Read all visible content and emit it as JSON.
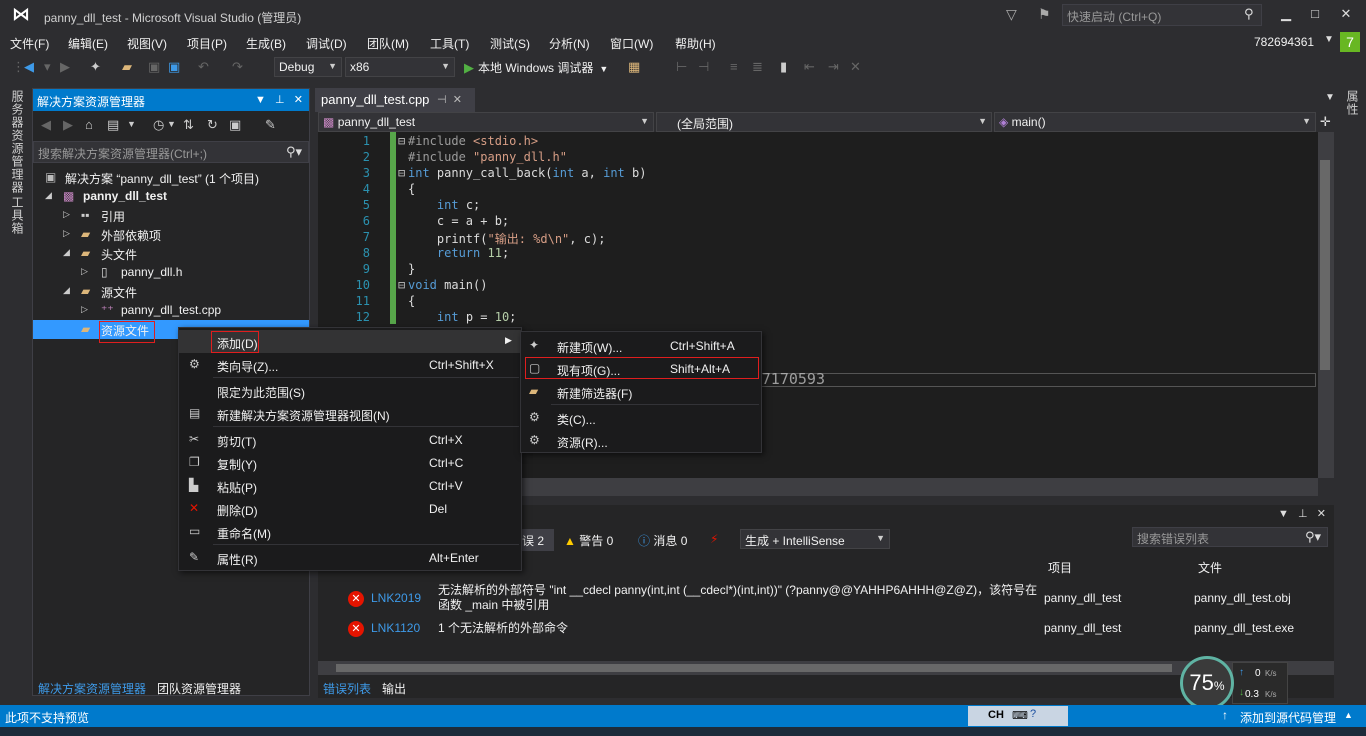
{
  "window": {
    "title": "panny_dll_test - Microsoft Visual Studio (管理员)",
    "quick_launch_placeholder": "快速启动 (Ctrl+Q)",
    "minimize": "▁",
    "maximize": "□",
    "close": "✕"
  },
  "menu": [
    "文件(F)",
    "编辑(E)",
    "视图(V)",
    "项目(P)",
    "生成(B)",
    "调试(D)",
    "团队(M)",
    "工具(T)",
    "测试(S)",
    "分析(N)",
    "窗口(W)",
    "帮助(H)"
  ],
  "account": {
    "id": "782694361",
    "notification_count": "7"
  },
  "toolbar": {
    "config": "Debug",
    "platform": "x86",
    "run_label": "本地 Windows 调试器"
  },
  "left_vtabs": [
    "服务器资源管理器",
    "工具箱"
  ],
  "right_vtab": "属性",
  "solution_explorer": {
    "title": "解决方案资源管理器",
    "search_placeholder": "搜索解决方案资源管理器(Ctrl+;)",
    "tree": [
      {
        "label": "解决方案 “panny_dll_test” (1 个项目)",
        "level": 0,
        "expander": "",
        "icon": "solution-icon",
        "bold": false
      },
      {
        "label": "panny_dll_test",
        "level": 1,
        "expander": "◢",
        "icon": "project-icon",
        "bold": true
      },
      {
        "label": "引用",
        "level": 2,
        "expander": "▷",
        "icon": "references-icon",
        "bold": false
      },
      {
        "label": "外部依赖项",
        "level": 2,
        "expander": "▷",
        "icon": "folder-icon",
        "bold": false
      },
      {
        "label": "头文件",
        "level": 2,
        "expander": "◢",
        "icon": "folder-icon",
        "bold": false
      },
      {
        "label": "panny_dll.h",
        "level": 3,
        "expander": "▷",
        "icon": "header-file-icon",
        "bold": false
      },
      {
        "label": "源文件",
        "level": 2,
        "expander": "◢",
        "icon": "folder-icon",
        "bold": false
      },
      {
        "label": "panny_dll_test.cpp",
        "level": 3,
        "expander": "▷",
        "icon": "cpp-file-icon",
        "bold": false
      },
      {
        "label": "资源文件",
        "level": 2,
        "expander": "",
        "icon": "folder-icon",
        "bold": false
      }
    ],
    "bottom_tabs": [
      "解决方案资源管理器",
      "团队资源管理器"
    ]
  },
  "editor": {
    "tab_label": "panny_dll_test.cpp",
    "nav_project": "panny_dll_test",
    "nav_scope": "(全局范围)",
    "nav_member": "main()",
    "line_numbers": [
      "1",
      "2",
      "3",
      "4",
      "5",
      "6",
      "7",
      "8",
      "9",
      "10",
      "11",
      "12"
    ],
    "code": [
      {
        "fold": "⊟",
        "parts": [
          [
            "pp",
            "#include "
          ],
          [
            "str",
            "<stdio.h>"
          ]
        ]
      },
      {
        "fold": "",
        "parts": [
          [
            "pp",
            "#include "
          ],
          [
            "str",
            "\"panny_dll.h\""
          ]
        ]
      },
      {
        "fold": "⊟",
        "parts": [
          [
            "kw",
            "int"
          ],
          [
            "",
            " panny_call_back("
          ],
          [
            "kw",
            "int"
          ],
          [
            "",
            " a, "
          ],
          [
            "kw",
            "int"
          ],
          [
            "",
            " b)"
          ]
        ]
      },
      {
        "fold": "",
        "parts": [
          [
            "",
            "{"
          ]
        ]
      },
      {
        "fold": "",
        "parts": [
          [
            "",
            "    "
          ],
          [
            "kw",
            "int"
          ],
          [
            "",
            " c;"
          ]
        ]
      },
      {
        "fold": "",
        "parts": [
          [
            "",
            "    c = a + b;"
          ]
        ]
      },
      {
        "fold": "",
        "parts": [
          [
            "",
            "    printf("
          ],
          [
            "str",
            "\"输出: %d\\n\""
          ],
          [
            "",
            ", c);"
          ]
        ]
      },
      {
        "fold": "",
        "parts": [
          [
            "",
            "    "
          ],
          [
            "kw",
            "return"
          ],
          [
            "",
            " "
          ],
          [
            "num",
            "11"
          ],
          [
            "",
            ";"
          ]
        ]
      },
      {
        "fold": "",
        "parts": [
          [
            "",
            "}"
          ]
        ]
      },
      {
        "fold": "⊟",
        "parts": [
          [
            "kw",
            "void"
          ],
          [
            "",
            " main()"
          ]
        ]
      },
      {
        "fold": "",
        "parts": [
          [
            "",
            "{"
          ]
        ]
      },
      {
        "fold": "",
        "parts": [
          [
            "",
            "    "
          ],
          [
            "kw",
            "int"
          ],
          [
            "",
            " p = "
          ],
          [
            "num",
            "10"
          ],
          [
            "",
            ";"
          ]
        ]
      }
    ],
    "watermark": "http://blog.csdn.net/m0_37170593"
  },
  "context_menu": {
    "items": [
      {
        "label": "添加(D)",
        "shortcut": "",
        "icon": "",
        "submenu": true
      },
      {
        "label": "类向导(Z)...",
        "shortcut": "Ctrl+Shift+X",
        "icon": "class-wizard-icon"
      },
      {
        "label": "限定为此范围(S)",
        "shortcut": "",
        "icon": ""
      },
      {
        "label": "新建解决方案资源管理器视图(N)",
        "shortcut": "",
        "icon": "new-view-icon"
      },
      {
        "label": "剪切(T)",
        "shortcut": "Ctrl+X",
        "icon": "cut-icon"
      },
      {
        "label": "复制(Y)",
        "shortcut": "Ctrl+C",
        "icon": "copy-icon"
      },
      {
        "label": "粘贴(P)",
        "shortcut": "Ctrl+V",
        "icon": "paste-icon"
      },
      {
        "label": "删除(D)",
        "shortcut": "Del",
        "icon": "delete-icon"
      },
      {
        "label": "重命名(M)",
        "shortcut": "",
        "icon": "rename-icon"
      },
      {
        "label": "属性(R)",
        "shortcut": "Alt+Enter",
        "icon": "properties-icon"
      }
    ]
  },
  "add_submenu": {
    "items": [
      {
        "label": "新建项(W)...",
        "shortcut": "Ctrl+Shift+A",
        "icon": "new-item-icon"
      },
      {
        "label": "现有项(G)...",
        "shortcut": "Shift+Alt+A",
        "icon": "existing-item-icon"
      },
      {
        "label": "新建筛选器(F)",
        "shortcut": "",
        "icon": "new-filter-icon"
      },
      {
        "label": "类(C)...",
        "shortcut": "",
        "icon": "class-icon"
      },
      {
        "label": "资源(R)...",
        "shortcut": "",
        "icon": "resource-icon"
      }
    ]
  },
  "error_list": {
    "errors_button": "误 2",
    "warnings_button": "警告 0",
    "messages_button": "消息 0",
    "build_filter": "生成 + IntelliSense",
    "search_placeholder": "搜索错误列表",
    "col_project": "项目",
    "col_file": "文件",
    "rows": [
      {
        "code": "LNK2019",
        "desc": "无法解析的外部符号 \"int __cdecl panny(int,int (__cdecl*)(int,int))\" (?panny@@YAHHP6AHHH@Z@Z)，该符号在函数 _main 中被引用",
        "project": "panny_dll_test",
        "file": "panny_dll_test.obj"
      },
      {
        "code": "LNK1120",
        "desc": "1 个无法解析的外部命令",
        "project": "panny_dll_test",
        "file": "panny_dll_test.exe"
      }
    ],
    "bottom_tabs": [
      "错误列表",
      "输出"
    ]
  },
  "network": {
    "percent": "75",
    "percent_sign": "%",
    "up": "0",
    "down": "0.3",
    "unit": "K/s"
  },
  "status": {
    "left": "此项不支持预览",
    "ime": "CH",
    "right": "添加到源代码管理"
  }
}
